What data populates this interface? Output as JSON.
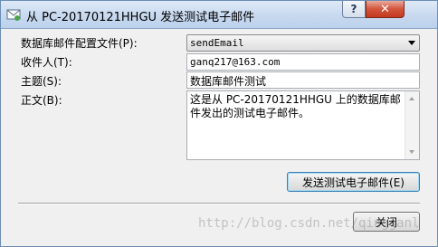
{
  "window": {
    "title": "从 PC-20170121HHGU 发送测试电子邮件",
    "help_button": "?",
    "close_button": "✕"
  },
  "form": {
    "profile_label": "数据库邮件配置文件(P):",
    "profile_value": "sendEmail",
    "recipient_label": "收件人(T):",
    "recipient_value": "ganq217@163.com",
    "subject_label": "主题(S):",
    "subject_value": "数据库邮件测试",
    "body_label": "正文(B):",
    "body_value": "这是从 PC-20170121HHGU 上的数据库邮件发出的测试电子邮件。"
  },
  "buttons": {
    "send_test": "发送测试电子邮件(E)",
    "close": "关闭"
  },
  "watermark": "http://blog.csdn.net/qingganl"
}
